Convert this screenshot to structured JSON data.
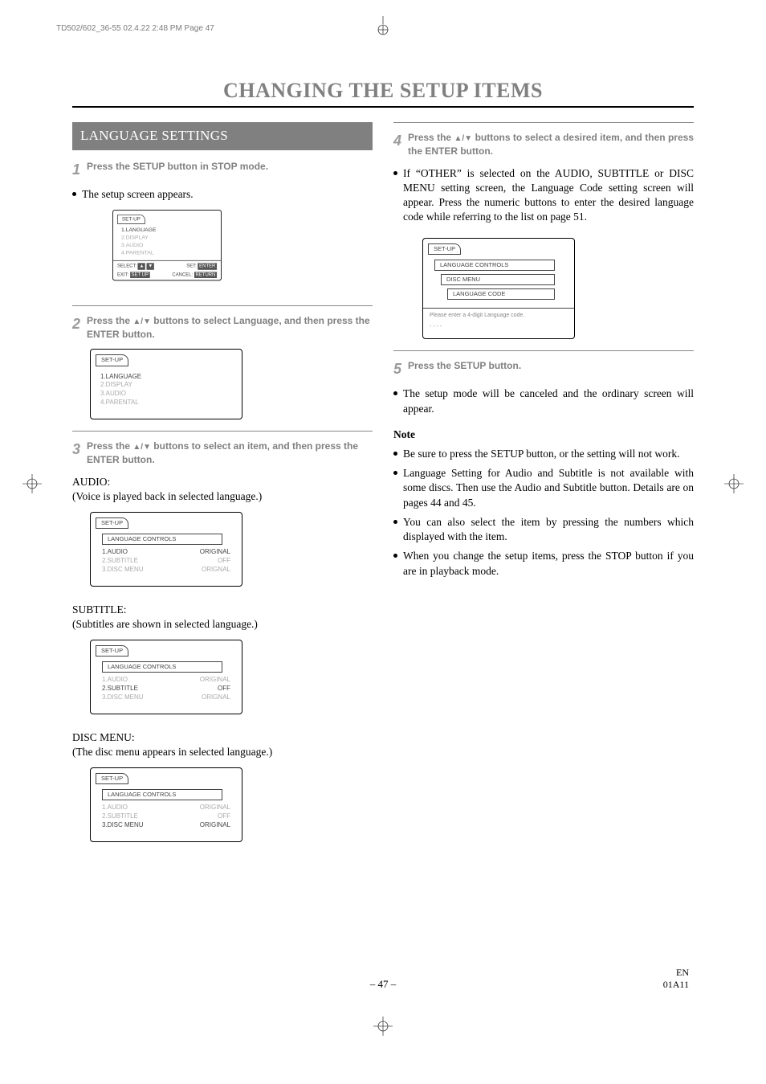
{
  "header_line": "TD502/602_36-55  02.4.22 2:48 PM  Page 47",
  "main_title": "CHANGING THE SETUP ITEMS",
  "section_title": "LANGUAGE SETTINGS",
  "left": {
    "step1_num": "1",
    "step1_txt": "Press the SETUP button in STOP mode.",
    "after_step1": "The setup screen appears.",
    "osd1": {
      "title": "SET-UP",
      "items": [
        "1.LANGUAGE",
        "2.DISPLAY",
        "3.AUDIO",
        "4.PARENTAL"
      ],
      "footer_select": "SELECT:",
      "footer_set": "SET:",
      "footer_set_btn": "ENTER",
      "footer_exit": "EXIT:",
      "footer_exit_btn": "SET UP",
      "footer_cancel": "CANCEL:",
      "footer_cancel_btn": "RETURN"
    },
    "step2_num": "2",
    "step2_txt_a": "Press the ",
    "step2_txt_b": " buttons to select Language, and then press the ENTER button.",
    "osd2": {
      "title": "SET-UP",
      "items": [
        "1.LANGUAGE",
        "2.DISPLAY",
        "3.AUDIO",
        "4.PARENTAL"
      ]
    },
    "step3_num": "3",
    "step3_txt_a": "Press the ",
    "step3_txt_b": " buttons to select an item, and then press the ENTER button.",
    "audio_head": "AUDIO:",
    "audio_caption": "(Voice is played back in selected language.)",
    "osd_audio": {
      "title": "SET-UP",
      "sub": "LANGUAGE CONTROLS",
      "rows": [
        [
          "1.AUDIO",
          "ORIGINAL"
        ],
        [
          "2.SUBTITLE",
          "OFF"
        ],
        [
          "3.DISC MENU",
          "ORIGNAL"
        ]
      ]
    },
    "subtitle_head": "SUBTITLE:",
    "subtitle_caption": "(Subtitles are shown in selected language.)",
    "osd_subtitle": {
      "title": "SET-UP",
      "sub": "LANGUAGE CONTROLS",
      "rows": [
        [
          "1.AUDIO",
          "ORIGINAL"
        ],
        [
          "2.SUBTITLE",
          "OFF"
        ],
        [
          "3.DISC MENU",
          "ORIGNAL"
        ]
      ]
    },
    "disc_head": "DISC MENU:",
    "disc_caption": "(The disc menu appears in selected language.)",
    "osd_disc": {
      "title": "SET-UP",
      "sub": "LANGUAGE CONTROLS",
      "rows": [
        [
          "1.AUDIO",
          "ORIGINAL"
        ],
        [
          "2.SUBTITLE",
          "OFF"
        ],
        [
          "3.DISC MENU",
          "ORIGINAL"
        ]
      ]
    }
  },
  "right": {
    "step4_num": "4",
    "step4_txt_a": "Press the ",
    "step4_txt_b": " buttons to select a desired item, and then press the ENTER button.",
    "para1": "If “OTHER” is selected on the AUDIO, SUBTITLE or DISC MENU setting screen, the Language Code setting screen will appear. Press the numeric buttons to enter the desired language code while referring to the list on page 51.",
    "osd_lang": {
      "title": "SET-UP",
      "sub1": "LANGUAGE CONTROLS",
      "sub2": "DISC MENU",
      "sub3": "LANGUAGE CODE",
      "msg": "Please enter a 4-digit Language code.",
      "dashes": "- - - -"
    },
    "step5_num": "5",
    "step5_txt": "Press the SETUP button.",
    "para2": "The setup mode will be canceled and the ordinary screen will appear.",
    "note_head": "Note",
    "notes": [
      "Be sure to press the SETUP button, or the setting will not work.",
      "Language Setting for Audio and Subtitle is not available with some discs. Then use the Audio and Subtitle button. Details are on pages 44 and 45.",
      "You can also select the item by pressing the numbers which displayed with the item.",
      "When you change the setup items, press the STOP button if you are in playback mode."
    ]
  },
  "page_number": "– 47 –",
  "page_lang": "EN",
  "page_code": "01A11"
}
